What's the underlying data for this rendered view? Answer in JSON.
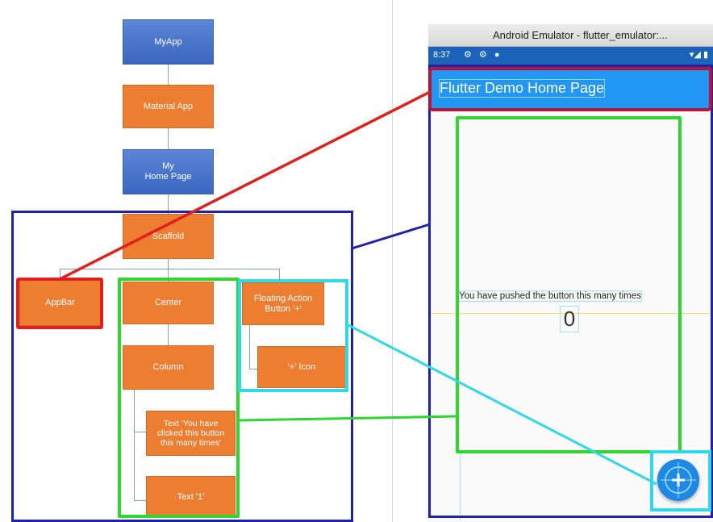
{
  "tree": {
    "myapp": "MyApp",
    "material_app": "Material App",
    "my_home_page": "My\nHome Page",
    "scaffold": "Scaffold",
    "appbar": "AppBar",
    "center": "Center",
    "fab": "Floating Action\nButton '+'",
    "column": "Column",
    "plus_icon": "'+' Icon",
    "text1": "Text 'You have\nclicked this button\nthis many times'",
    "text2": "Text '1'"
  },
  "emulator": {
    "window_title": "Android Emulator - flutter_emulator:...",
    "status_time": "8:37",
    "appbar_title": "Flutter Demo Home Page",
    "body_text": "You have pushed the button this many times",
    "counter": "0"
  },
  "colors": {
    "node_blue": "#4472c4",
    "node_orange": "#ed7d31",
    "highlight_red": "#e0201c",
    "highlight_green": "#2fd62f",
    "highlight_cyan": "#2fd9e8",
    "highlight_navy": "#1f22a8",
    "appbar_blue": "#2196f3"
  }
}
